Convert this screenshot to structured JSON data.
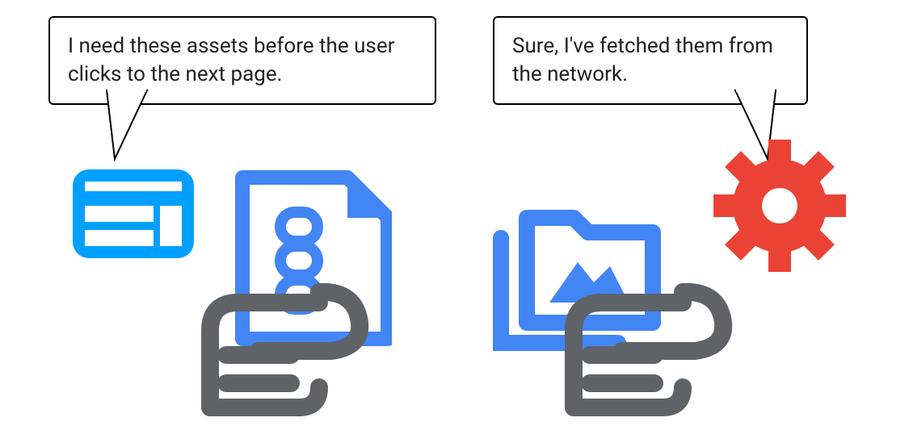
{
  "speech": {
    "left": "I need these assets before the user clicks to the next page.",
    "right": "Sure, I've fetched them from the network."
  },
  "colors": {
    "primaryBlue": "#1a8cff",
    "docBlue": "#4285f4",
    "grayStroke": "#5f6368",
    "gearRed": "#ea4335"
  },
  "icons": {
    "browser_window": "browser-window-icon",
    "document_chain": "document-chain-icon",
    "hand_left": "hand-icon",
    "folder_image": "image-folder-icon",
    "hand_right": "hand-icon",
    "gear": "gear-icon"
  }
}
